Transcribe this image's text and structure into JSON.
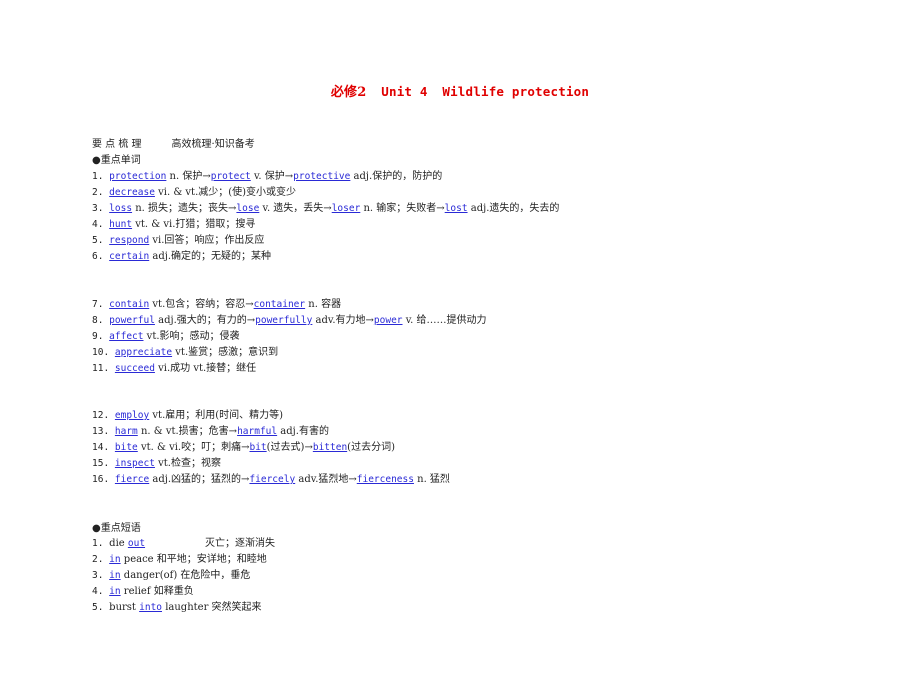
{
  "title": {
    "part1": "必修2",
    "part2": "Unit 4",
    "part3": "Wildlife protection"
  },
  "header": {
    "label": "要 点 梳 理",
    "subtitle": "高效梳理·知识备考"
  },
  "vocab_section": "●重点单词",
  "phrase_section": "●重点短语",
  "colors": {
    "title": "#e00000",
    "keyword": "#2a2ad6",
    "text": "#222222"
  },
  "vocab": [
    {
      "num": "1.",
      "segments": [
        {
          "k": "protection"
        },
        {
          "t": " n. 保护→"
        },
        {
          "k": "protect"
        },
        {
          "t": " v. 保护→"
        },
        {
          "k": "protective"
        },
        {
          "t": " adj.保护的，防护的"
        }
      ]
    },
    {
      "num": "2.",
      "segments": [
        {
          "k": "decrease"
        },
        {
          "t": " vi. & vt.减少；(使)变小或变少"
        }
      ]
    },
    {
      "num": "3.",
      "segments": [
        {
          "k": "loss"
        },
        {
          "t": " n. 损失；遗失；丧失→"
        },
        {
          "k": "lose"
        },
        {
          "t": " v. 遗失，丢失→"
        },
        {
          "k": "loser"
        },
        {
          "t": " n. 输家；失败者→"
        },
        {
          "k": "lost"
        },
        {
          "t": " adj.遗失的，失去的"
        }
      ]
    },
    {
      "num": "4.",
      "segments": [
        {
          "k": "hunt"
        },
        {
          "t": " vt. & vi.打猎；猎取；搜寻"
        }
      ]
    },
    {
      "num": "5.",
      "segments": [
        {
          "k": "respond"
        },
        {
          "t": " vi.回答；响应；作出反应"
        }
      ]
    },
    {
      "num": "6.",
      "segments": [
        {
          "k": "certain"
        },
        {
          "t": " adj.确定的；无疑的；某种"
        }
      ]
    },
    {
      "num": "7.",
      "segments": [
        {
          "k": "contain"
        },
        {
          "t": " vt.包含；容纳；容忍→"
        },
        {
          "k": "container"
        },
        {
          "t": " n. 容器"
        }
      ]
    },
    {
      "num": "8.",
      "segments": [
        {
          "k": "powerful"
        },
        {
          "t": " adj.强大的；有力的→"
        },
        {
          "k": "powerfully"
        },
        {
          "t": " adv.有力地→"
        },
        {
          "k": "power"
        },
        {
          "t": " v. 给……提供动力"
        }
      ]
    },
    {
      "num": "9.",
      "segments": [
        {
          "k": "affect"
        },
        {
          "t": " vt.影响；感动；侵袭"
        }
      ]
    },
    {
      "num": "10.",
      "segments": [
        {
          "k": "appreciate"
        },
        {
          "t": " vt.鉴赏；感激；意识到"
        }
      ]
    },
    {
      "num": "11.",
      "segments": [
        {
          "k": "succeed"
        },
        {
          "t": " vi.成功 vt.接替；继任"
        }
      ]
    },
    {
      "num": "12.",
      "segments": [
        {
          "k": "employ"
        },
        {
          "t": " vt.雇用；利用(时间、精力等)"
        }
      ]
    },
    {
      "num": "13.",
      "segments": [
        {
          "k": "harm"
        },
        {
          "t": " n. & vt.损害；危害→"
        },
        {
          "k": "harmful"
        },
        {
          "t": " adj.有害的"
        }
      ]
    },
    {
      "num": "14.",
      "segments": [
        {
          "k": "bite"
        },
        {
          "t": " vt. & vi.咬；叮；刺痛→"
        },
        {
          "k": "bit"
        },
        {
          "t": "(过去式)→"
        },
        {
          "k": "bitten"
        },
        {
          "t": "(过去分词)"
        }
      ]
    },
    {
      "num": "15.",
      "segments": [
        {
          "k": "inspect"
        },
        {
          "t": " vt.检查；视察"
        }
      ]
    },
    {
      "num": "16.",
      "segments": [
        {
          "k": "fierce"
        },
        {
          "t": " adj.凶猛的；猛烈的→"
        },
        {
          "k": "fiercely"
        },
        {
          "t": " adv.猛烈地→"
        },
        {
          "k": "fierceness"
        },
        {
          "t": " n. 猛烈"
        }
      ]
    }
  ],
  "phrases": [
    {
      "num": "1.",
      "segments": [
        {
          "t": "die "
        },
        {
          "k": "out"
        },
        {
          "gap": "wide"
        },
        {
          "t": "灭亡；逐渐消失"
        }
      ]
    },
    {
      "num": "2.",
      "segments": [
        {
          "k": "in"
        },
        {
          "t": " peace  和平地；安详地；和睦地"
        }
      ]
    },
    {
      "num": "3.",
      "segments": [
        {
          "k": "in"
        },
        {
          "t": " danger(of)  在危险中，垂危"
        }
      ]
    },
    {
      "num": "4.",
      "segments": [
        {
          "k": "in"
        },
        {
          "t": " relief  如释重负"
        }
      ]
    },
    {
      "num": "5.",
      "segments": [
        {
          "t": "burst "
        },
        {
          "k": "into"
        },
        {
          "t": " laughter  突然笑起来"
        }
      ]
    }
  ]
}
